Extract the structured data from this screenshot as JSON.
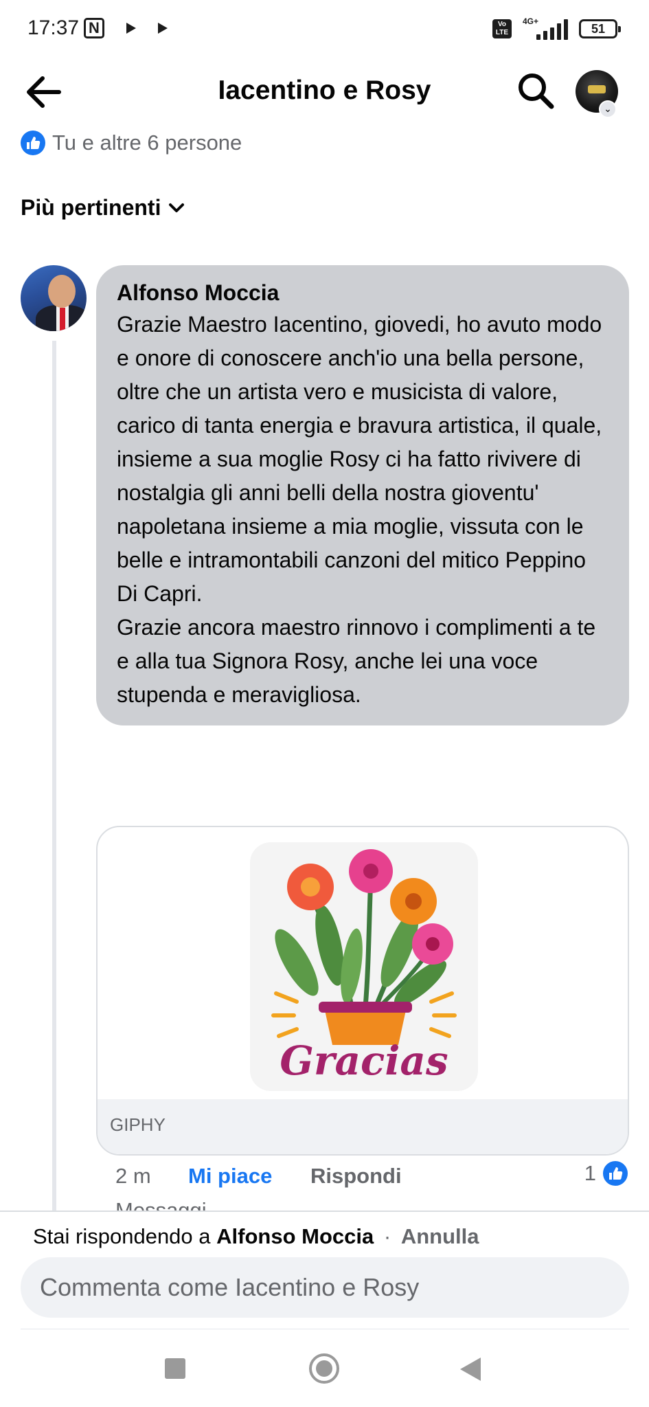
{
  "status_bar": {
    "time": "17:37",
    "nfc_glyph": "N",
    "network": "4G+",
    "volte_line1": "Vo",
    "volte_line2": "LTE",
    "battery": "51",
    "icons": [
      "nfc-icon",
      "play-icon",
      "play-icon",
      "volte-icon",
      "signal-icon",
      "battery-icon"
    ]
  },
  "header": {
    "title": "Iacentino e Rosy",
    "back_icon": "arrow-left-icon",
    "search_icon": "search-icon",
    "dropdown_glyph": "⌄"
  },
  "reactions": {
    "summary": "Tu e altre 6 persone",
    "icon": "thumbs-up-icon"
  },
  "sort": {
    "label": "Più pertinenti",
    "icon": "chevron-down-icon"
  },
  "comment": {
    "author": "Alfonso Moccia",
    "text": "Grazie Maestro Iacentino, giovedi, ho avuto modo e onore di conoscere anch'io una bella persone, oltre che un artista vero e musicista di valore, carico di tanta energia e bravura artistica, il quale, insieme a sua moglie Rosy ci ha fatto rivivere di nostalgia gli anni belli della nostra gioventu' napoletana insieme a mia moglie, vissuta con le belle e intramontabili canzoni del mitico Peppino Di Capri.\nGrazie ancora maestro rinnovo i complimenti a te e alla tua Signora Rosy, anche lei una voce stupenda e meravigliosa.",
    "gif_caption": "Gracias",
    "gif_source": "GIPHY",
    "time_ago": "2 m",
    "like_label": "Mi piace",
    "reply_label": "Rispondi",
    "like_count": "1",
    "cutoff_text": "Messaggi",
    "colors": {
      "accent": "#1877f2",
      "bubble": "#cdcfd3",
      "muted": "#65676b"
    }
  },
  "composer": {
    "replying_prefix": "Stai rispondendo a",
    "replying_name": "Alfonso Moccia",
    "separator": "·",
    "cancel_label": "Annulla",
    "placeholder": "Commenta come Iacentino e Rosy"
  },
  "nav": {
    "icons": [
      "recent-apps-icon",
      "home-icon",
      "back-triangle-icon"
    ]
  }
}
